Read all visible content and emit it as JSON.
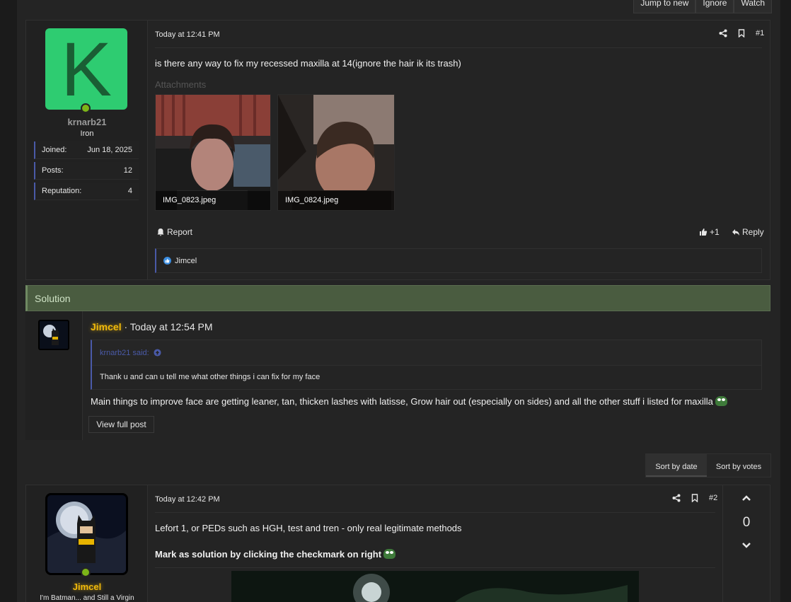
{
  "thread_buttons": [
    "Jump to new",
    "Ignore",
    "Watch"
  ],
  "post1": {
    "avatar_letter": "K",
    "username": "krnarb21",
    "user_title": "Iron",
    "stats": [
      {
        "label": "Joined:",
        "value": "Jun 18, 2025"
      },
      {
        "label": "Posts:",
        "value": "12"
      },
      {
        "label": "Reputation:",
        "value": "4"
      }
    ],
    "date": "Today at 12:41 PM",
    "number": "#1",
    "text": "is there any way to fix my recessed maxilla at 14(ignore the hair ik its trash)",
    "attachments_label": "Attachments",
    "attachments": [
      "IMG_0823.jpeg",
      "IMG_0824.jpeg"
    ],
    "report_label": "Report",
    "like_count": "+1",
    "reply_label": "Reply",
    "liked_by": "Jimcel"
  },
  "solution": {
    "header": "Solution",
    "author": "Jimcel",
    "date": "· Today at 12:54 PM",
    "quote_author": "krnarb21 said:",
    "quote_text": "Thank u and can u tell me what other things i can fix for my face",
    "text": "Main things to improve face are getting leaner, tan, thicken lashes with latisse, Grow hair out (especially on sides) and all the other stuff i listed for maxilla",
    "view_full_label": "View full post"
  },
  "sort": {
    "by_date": "Sort by date",
    "by_votes": "Sort by votes"
  },
  "post2": {
    "username": "Jimcel",
    "user_title": "I'm Batman... and Still a Virgin",
    "date": "Today at 12:42 PM",
    "number": "#2",
    "text": "Lefort 1, or PEDs such as HGH, test and tren - only real legitimate methods",
    "bold_text": "Mark as solution by clicking the checkmark on right",
    "vote_count": "0"
  },
  "colors": {
    "accent": "#4a5aa8",
    "solution_bg": "#4a5c40",
    "avatar_green": "#2ecc71",
    "gold": "#f0b90b"
  }
}
